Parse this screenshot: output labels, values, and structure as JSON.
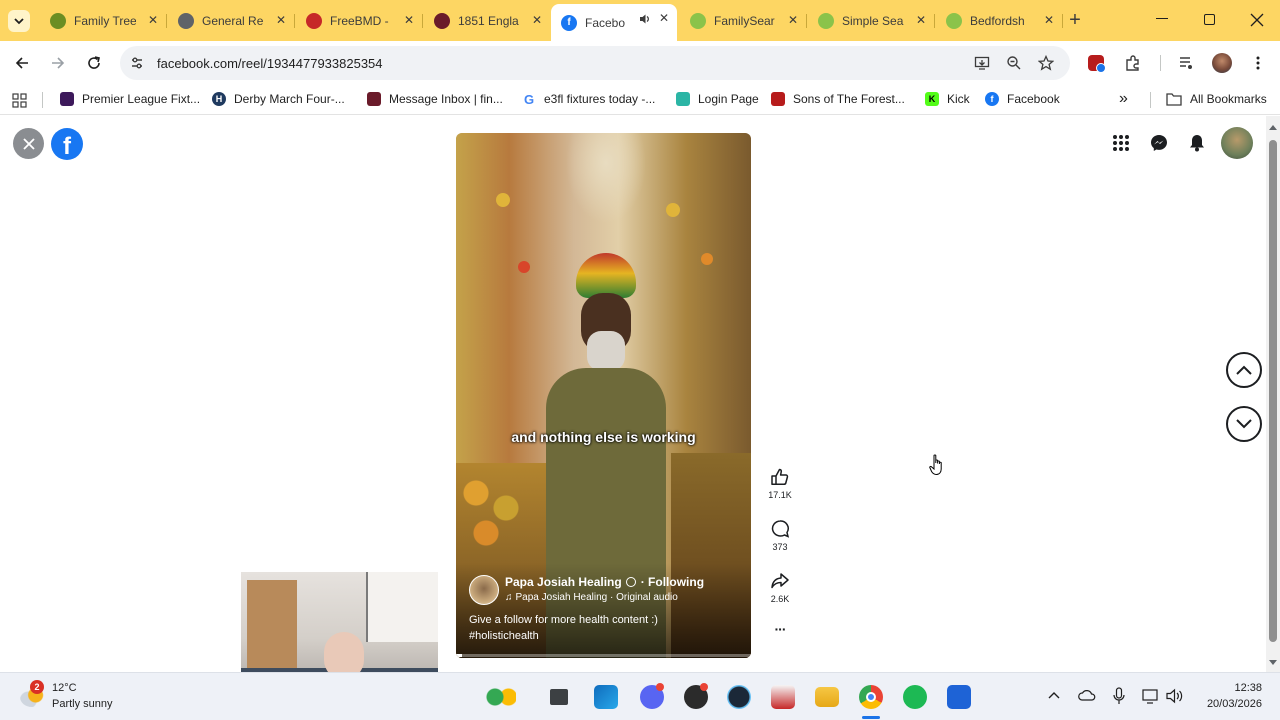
{
  "browser": {
    "tabs": [
      {
        "title": "Family Tree",
        "favicon": "leaf-icon",
        "color": "#6b8e23"
      },
      {
        "title": "General Re",
        "favicon": "globe-icon",
        "color": "#5f6368"
      },
      {
        "title": "FreeBMD -",
        "favicon": "freebmd-icon",
        "color": "#c62828"
      },
      {
        "title": "1851 Engla",
        "favicon": "ancestry-icon",
        "color": "#6a1b2a"
      },
      {
        "title": "Facebo",
        "favicon": "facebook-icon",
        "color": "#1877f2",
        "active": true
      },
      {
        "title": "FamilySear",
        "favicon": "familysearch-icon",
        "color": "#8bc34a"
      },
      {
        "title": "Simple Sea",
        "favicon": "familysearch-icon",
        "color": "#8bc34a"
      },
      {
        "title": "Bedfordsh",
        "favicon": "familysearch-icon",
        "color": "#8bc34a"
      }
    ],
    "new_tab": "+",
    "url": "facebook.com/reel/1934477933825354",
    "bookmarks": [
      {
        "label": "Premier League Fixt...",
        "icon": "premier-league-icon",
        "color": "#3d195b"
      },
      {
        "label": "Derby March Four-...",
        "icon": "h-icon",
        "color": "#1f3a5f"
      },
      {
        "label": "Message Inbox | fin...",
        "icon": "inbox-icon",
        "color": "#6a1b2a"
      },
      {
        "label": "e3fl fixtures today -...",
        "icon": "google-icon",
        "color": "#4285f4"
      },
      {
        "label": "Login Page",
        "icon": "login-icon",
        "color": "#2bb5a5"
      },
      {
        "label": "Sons of The Forest...",
        "icon": "sons-forest-icon",
        "color": "#b71c1c"
      },
      {
        "label": "Kick",
        "icon": "kick-icon",
        "color": "#53fc18"
      },
      {
        "label": "Facebook",
        "icon": "facebook-icon",
        "color": "#1877f2"
      }
    ],
    "all_bookmarks": "All Bookmarks",
    "more_chevron": "»"
  },
  "reel": {
    "caption_overlay": "and nothing else is working",
    "author": "Papa Josiah Healing",
    "follow_state": "· Following",
    "audio": "Papa Josiah Healing · Original audio",
    "description_line1": "Give a follow for more health content :)",
    "description_line2": "#holistichealth",
    "likes": "17.1K",
    "comments": "373",
    "shares": "2.6K",
    "more": "···"
  },
  "taskbar": {
    "weather_temp": "12°C",
    "weather_desc": "Partly sunny",
    "weather_badge": "2",
    "time": "12:38",
    "date": "20/03/2026"
  },
  "colors": {
    "tabbar": "#fdd663",
    "facebook_blue": "#1877f2",
    "page_bg": "#ffffff"
  }
}
